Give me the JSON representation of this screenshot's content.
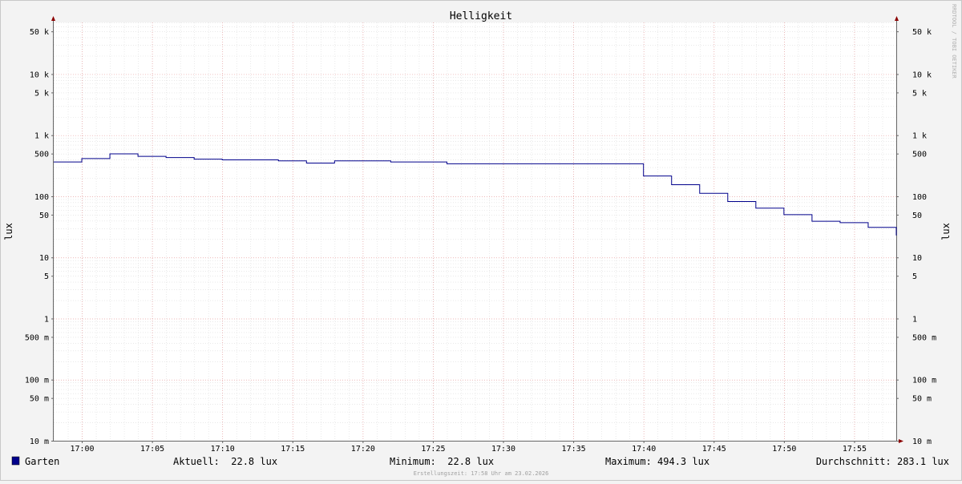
{
  "chart_data": {
    "type": "line",
    "title": "Helligkeit",
    "ylabel": "lux",
    "ylabel_right": "lux",
    "y_scale": "log",
    "ylim": [
      0.01,
      70000
    ],
    "y_ticks": [
      {
        "v": 50000,
        "label": "50 k"
      },
      {
        "v": 10000,
        "label": "10 k"
      },
      {
        "v": 5000,
        "label": "5 k"
      },
      {
        "v": 1000,
        "label": "1 k"
      },
      {
        "v": 500,
        "label": "500"
      },
      {
        "v": 100,
        "label": "100"
      },
      {
        "v": 50,
        "label": "50"
      },
      {
        "v": 10,
        "label": "10"
      },
      {
        "v": 5,
        "label": "5"
      },
      {
        "v": 1,
        "label": "1"
      },
      {
        "v": 0.5,
        "label": "500 m"
      },
      {
        "v": 0.1,
        "label": "100 m"
      },
      {
        "v": 0.05,
        "label": "50 m"
      },
      {
        "v": 0.01,
        "label": "10 m"
      }
    ],
    "xlim": [
      "16:58",
      "17:58"
    ],
    "x_ticks": [
      "17:00",
      "17:05",
      "17:10",
      "17:15",
      "17:20",
      "17:25",
      "17:30",
      "17:35",
      "17:40",
      "17:45",
      "17:50",
      "17:55"
    ],
    "grid": true,
    "series": [
      {
        "name": "Garten",
        "color": "#00008b",
        "step": true,
        "x": [
          "16:58",
          "17:00",
          "17:02",
          "17:04",
          "17:06",
          "17:08",
          "17:10",
          "17:14",
          "17:16",
          "17:18",
          "17:22",
          "17:26",
          "17:36",
          "17:40",
          "17:42",
          "17:44",
          "17:46",
          "17:48",
          "17:50",
          "17:52",
          "17:54",
          "17:56",
          "17:58"
        ],
        "values": [
          365,
          415,
          494.3,
          450,
          430,
          405,
          395,
          380,
          350,
          380,
          365,
          340,
          340,
          215,
          155,
          112,
          82,
          64,
          50,
          39,
          37,
          31,
          22.8
        ]
      }
    ]
  },
  "legend": {
    "series_name": "Garten",
    "series_color": "#00008b",
    "current": "Aktuell:  22.8 lux",
    "minimum": "Minimum:  22.8 lux",
    "maximum": "Maximum: 494.3 lux",
    "average": "Durchschnitt: 283.1 lux"
  },
  "footer": "Erstellungszeit: 17:58 Uhr am 23.02.2026",
  "watermark": "RRDTOOL / TOBI OETIKER"
}
